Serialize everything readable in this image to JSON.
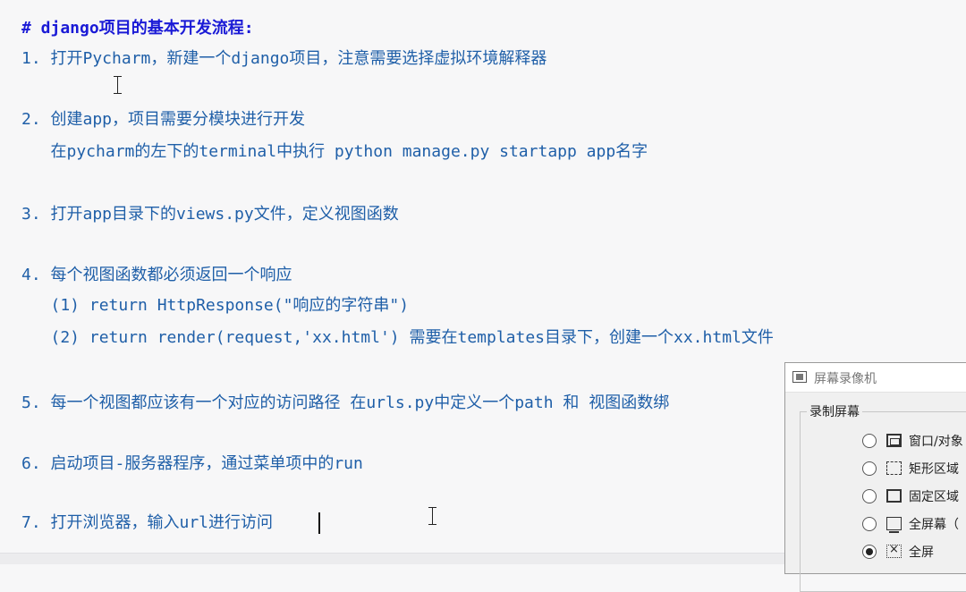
{
  "editor": {
    "lines": [
      "# django项目的基本开发流程:",
      "1. 打开Pycharm，新建一个django项目，注意需要选择虚拟环境解释器",
      "2. 创建app，项目需要分模块进行开发",
      "   在pycharm的左下的terminal中执行 python manage.py startapp app名字",
      "3. 打开app目录下的views.py文件，定义视图函数",
      "4. 每个视图函数都必须返回一个响应",
      "   (1) return HttpResponse(\"响应的字符串\")",
      "   (2) return render(request,'xx.html') 需要在templates目录下，创建一个xx.html文件",
      "5. 每一个视图都应该有一个对应的访问路径 在urls.py中定义一个path 和 视图函数绑",
      "6. 启动项目-服务器程序，通过菜单项中的run",
      "7. 打开浏览器，输入url进行访问"
    ]
  },
  "recorder": {
    "title": "屏幕录像机",
    "group_label": "录制屏幕",
    "options": [
      {
        "label": "窗口/对象",
        "icon": "window-icon",
        "checked": false
      },
      {
        "label": "矩形区域",
        "icon": "rectangle-region-icon",
        "checked": false
      },
      {
        "label": "固定区域",
        "icon": "fixed-region-icon",
        "checked": false
      },
      {
        "label": "全屏幕（",
        "icon": "fullscreen-monitor-icon",
        "checked": false
      },
      {
        "label": "全屏",
        "icon": "full-icon",
        "checked": true
      }
    ]
  }
}
